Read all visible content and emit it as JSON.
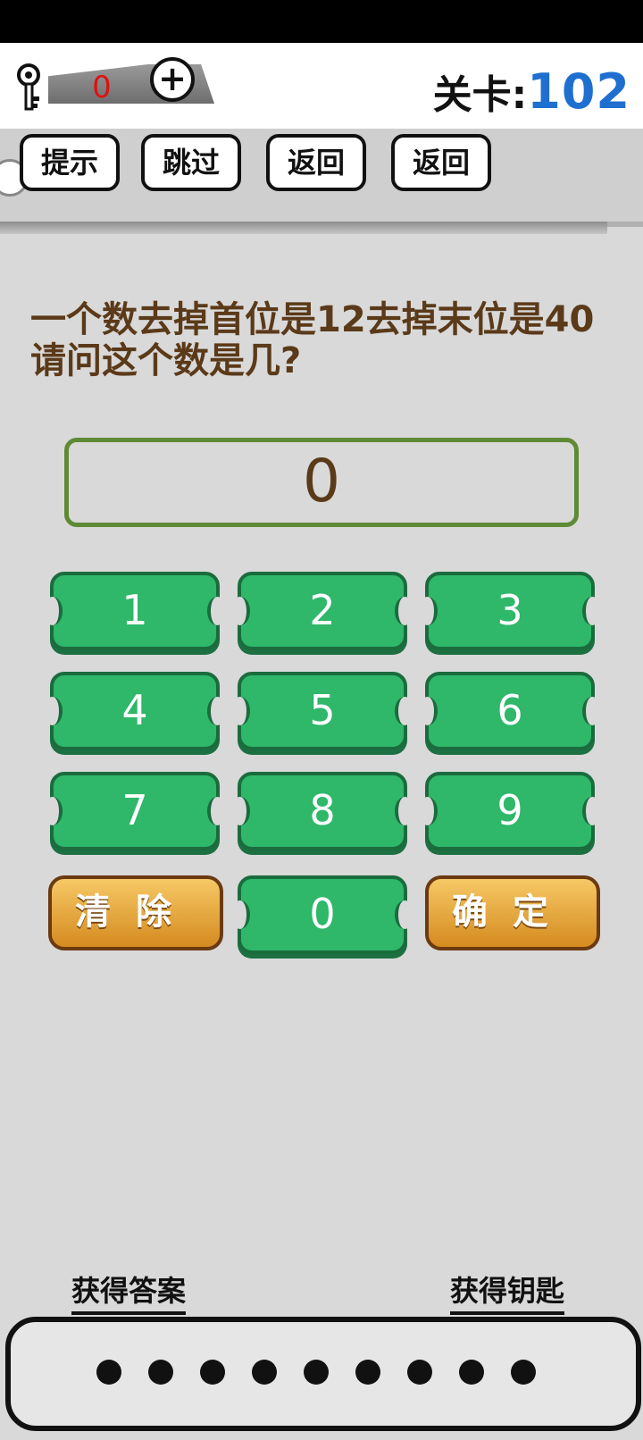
{
  "header": {
    "key_count": "0",
    "plus_label": "+",
    "level_label": "关卡:",
    "level_number": "102"
  },
  "toolbar": {
    "buttons": [
      "提示",
      "跳过",
      "返回",
      "返回"
    ]
  },
  "puzzle": {
    "question": "一个数去掉首位是12去掉末位是40 请问这个数是几?",
    "answer_value": "0"
  },
  "keypad": {
    "digits": [
      "1",
      "2",
      "3",
      "4",
      "5",
      "6",
      "7",
      "8",
      "9",
      "0"
    ],
    "clear_label": "清除",
    "confirm_label": "确定"
  },
  "footer": {
    "get_answer_label": "获得答案",
    "get_key_label": "获得钥匙",
    "dot_count_shown": 9
  },
  "colors": {
    "accent_blue": "#1f6fd0",
    "key_count_red": "#e01010",
    "question_brown": "#5b3a19",
    "keypad_green": "#2fb76a",
    "wood_orange": "#d58b20"
  }
}
